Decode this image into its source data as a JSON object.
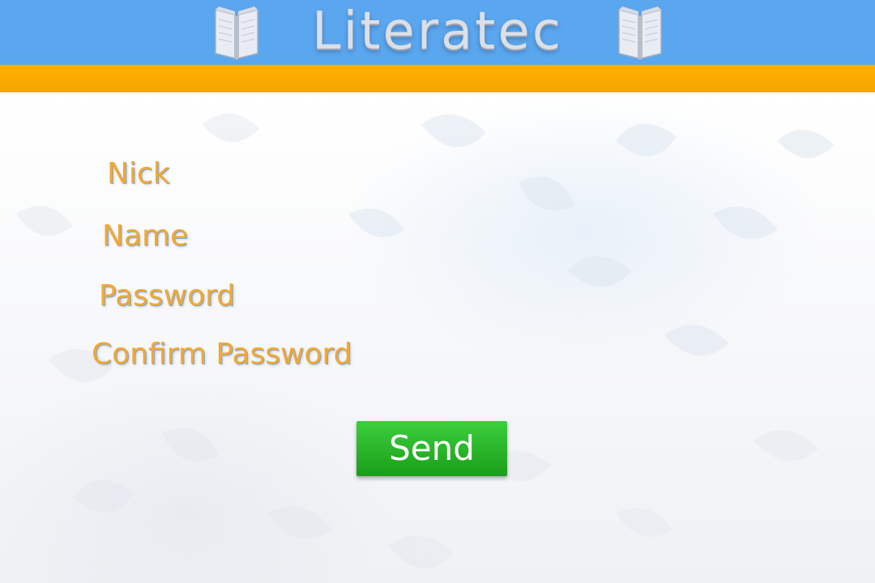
{
  "header": {
    "title": "Literatec",
    "icons": {
      "left": "open-book-icon",
      "right": "open-book-icon"
    }
  },
  "form": {
    "labels": {
      "nick": "Nick",
      "name": "Name",
      "password": "Password",
      "confirm_password": "Confirm Password"
    },
    "send_label": "Send"
  },
  "colors": {
    "header_blue": "#5aa6ef",
    "header_orange": "#ffb300",
    "label_orange": "#f2a833",
    "button_green": "#28b428",
    "title_silver": "#dcdfe6"
  }
}
